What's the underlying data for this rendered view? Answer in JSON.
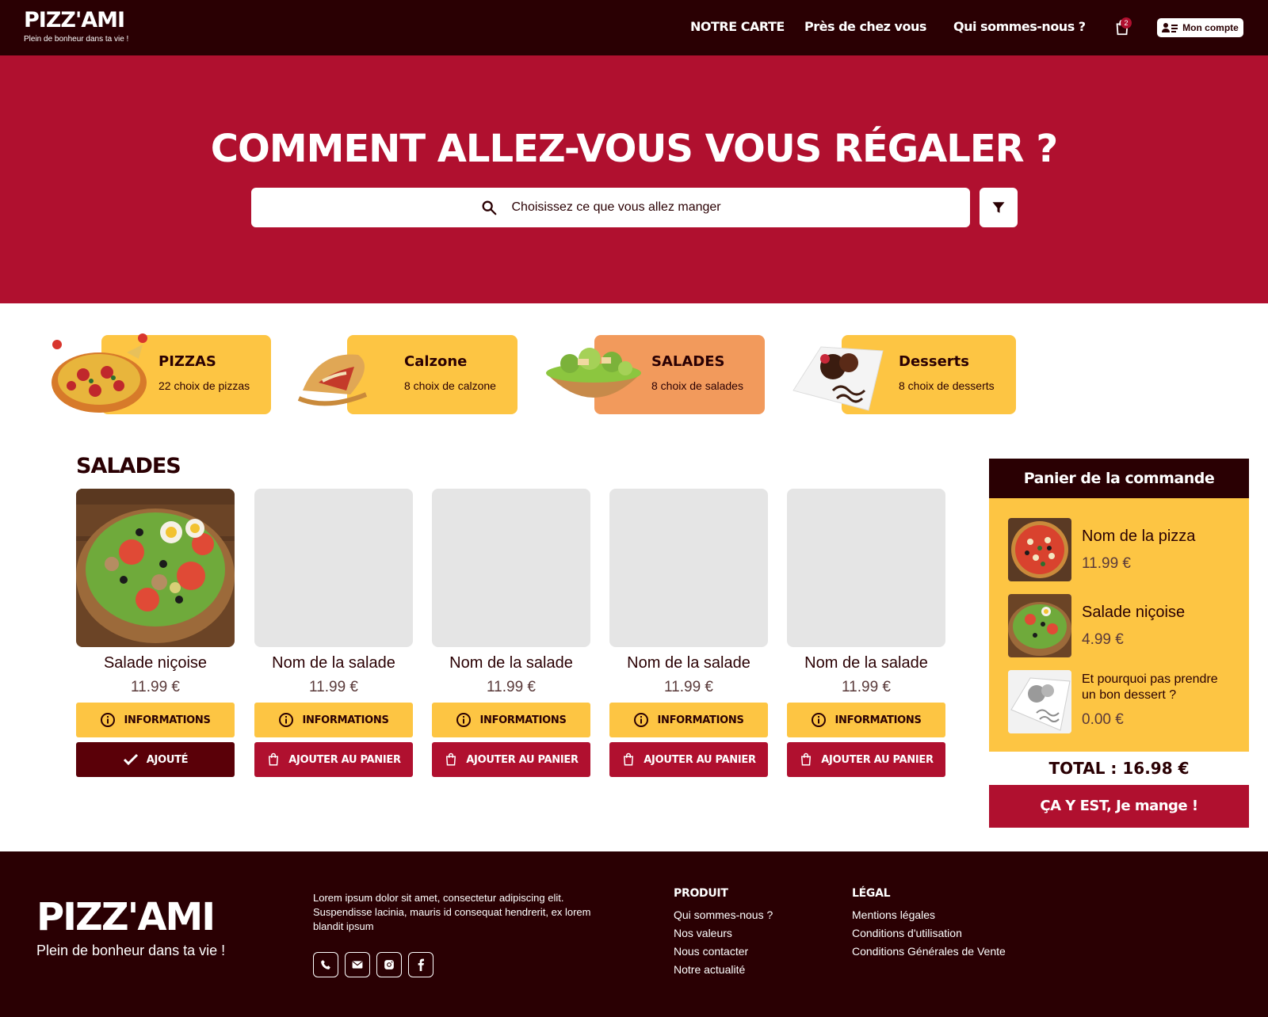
{
  "brand": {
    "name": "PIZZ'AMI",
    "tagline": "Plein de bonheur dans ta vie !"
  },
  "nav": {
    "items": [
      "NOTRE CARTE",
      "Près de chez vous",
      "Qui sommes-nous ?"
    ],
    "cart_count": "2",
    "account_label": "Mon compte"
  },
  "hero": {
    "title": "COMMENT ALLEZ-VOUS VOUS RÉGALER ?",
    "search_placeholder": "Choisissez ce que vous allez manger"
  },
  "categories": [
    {
      "title": "PIZZAS",
      "subtitle": "22 choix de pizzas",
      "active": false
    },
    {
      "title": "Calzone",
      "subtitle": "8 choix de calzone",
      "active": false
    },
    {
      "title": "SALADES",
      "subtitle": "8 choix de salades",
      "active": true
    },
    {
      "title": "Desserts",
      "subtitle": "8 choix de desserts",
      "active": false
    }
  ],
  "section": {
    "title": "SALADES"
  },
  "products": [
    {
      "name": "Salade niçoise",
      "price": "11.99 €",
      "info_label": "INFORMATIONS",
      "action_label": "AJOUTÉ",
      "added": true
    },
    {
      "name": "Nom de la salade",
      "price": "11.99 €",
      "info_label": "INFORMATIONS",
      "action_label": "AJOUTER AU PANIER",
      "added": false
    },
    {
      "name": "Nom de la salade",
      "price": "11.99 €",
      "info_label": "INFORMATIONS",
      "action_label": "AJOUTER AU PANIER",
      "added": false
    },
    {
      "name": "Nom de la salade",
      "price": "11.99 €",
      "info_label": "INFORMATIONS",
      "action_label": "AJOUTER AU PANIER",
      "added": false
    },
    {
      "name": "Nom de la salade",
      "price": "11.99 €",
      "info_label": "INFORMATIONS",
      "action_label": "AJOUTER AU PANIER",
      "added": false
    }
  ],
  "basket": {
    "title": "Panier de la commande",
    "items": [
      {
        "name": "Nom de la pizza",
        "price": "11.99 €"
      },
      {
        "name": "Salade niçoise",
        "price": "4.99 €"
      },
      {
        "name_line1": "Et pourquoi pas prendre",
        "name_line2": "un bon dessert ?",
        "price": "0.00 €"
      }
    ],
    "total": "TOTAL : 16.98 €",
    "cta": "ÇA Y EST, Je mange !"
  },
  "footer": {
    "description": "Lorem ipsum dolor sit amet, consectetur adipiscing elit. Suspendisse lacinia, mauris id consequat hendrerit, ex lorem blandit ipsum",
    "socials": [
      "phone-icon",
      "mail-icon",
      "instagram-icon",
      "facebook-icon"
    ],
    "product": {
      "title": "PRODUIT",
      "links": [
        "Qui sommes-nous ?",
        "Nos valeurs",
        "Nous contacter",
        "Notre actualité"
      ]
    },
    "legal": {
      "title": "LÉGAL",
      "links": [
        "Mentions légales",
        "Conditions d'utilisation",
        "Conditions Générales de Vente"
      ]
    }
  },
  "colors": {
    "dark": "#2a0003",
    "primary": "#b0102f",
    "yellow": "#fdc543",
    "orange_active": "#f29a5c",
    "added_button": "#5a0008"
  }
}
